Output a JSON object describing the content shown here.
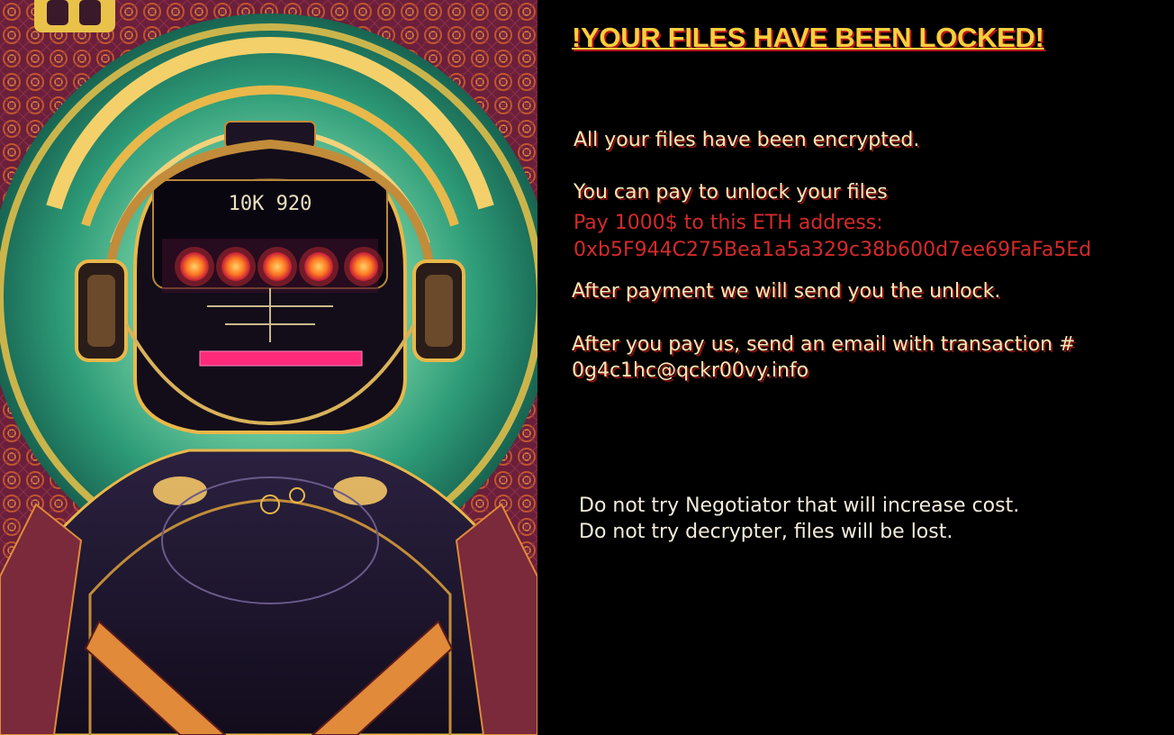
{
  "ransom_note": {
    "title": "!YOUR FILES HAVE BEEN LOCKED!",
    "encrypted_line": "All your files have been encrypted.",
    "pay_line": "You can pay to unlock your files",
    "pay_amount_line": "Pay 1000$ to this ETH address:",
    "eth_address": "0xb5F944C275Bea1a5a329c38b600d7ee69FaFa5Ed",
    "after_payment_line": "After payment we will send you the unlock.",
    "email_instruction_line": "After you pay us, send an email with transaction #",
    "contact_email": "0g4c1hc@qckr00vy.info",
    "warning_negotiator": "Do not try Negotiator that will increase cost.",
    "warning_decrypter": "Do not try decrypter, files will be lost."
  },
  "artwork": {
    "visor_text": "10K 920",
    "colors": {
      "glow_green": "#5fcf9a",
      "ring_yellow": "#e9c24a",
      "eye_orange": "#ff8a2a",
      "magenta": "#ff2a7a",
      "background": "#000000"
    }
  }
}
